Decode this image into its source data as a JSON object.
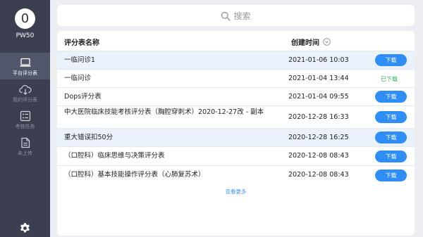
{
  "user": {
    "avatar": "0",
    "name": "PW50"
  },
  "nav": [
    {
      "label": "平台评分表",
      "icon": "laptop-icon",
      "active": true
    },
    {
      "label": "我的评分表",
      "icon": "cloud-download-icon",
      "active": false
    },
    {
      "label": "考核任务",
      "icon": "task-list-icon",
      "active": false
    },
    {
      "label": "未上传",
      "icon": "document-icon",
      "active": false
    }
  ],
  "search": {
    "placeholder": "搜索"
  },
  "table": {
    "header_name": "评分表名称",
    "header_date": "创建时间",
    "rows": [
      {
        "name": "一临问诊1",
        "date": "2021-01-06 10:03",
        "action": "下载",
        "downloaded": false
      },
      {
        "name": "一临问诊",
        "date": "2021-01-04 13:44",
        "action": "已下载",
        "downloaded": true
      },
      {
        "name": "Dops评分表",
        "date": "2021-01-04 09:55",
        "action": "下载",
        "downloaded": false
      },
      {
        "name": "中大医院临床技能考核评分表（胸腔穿刺术）2020-12-27改 - 副本",
        "date": "2020-12-28 16:33",
        "action": "下载",
        "downloaded": false
      },
      {
        "name": "重大错误扣50分",
        "date": "2020-12-28 16:25",
        "action": "下载",
        "downloaded": false
      },
      {
        "name": "（口腔科）临床思维与决策评分表",
        "date": "2020-12-08 08:43",
        "action": "下载",
        "downloaded": false
      },
      {
        "name": "（口腔科）基本技能操作评分表（心肺复苏术）",
        "date": "2020-12-08 08:43",
        "action": "下载",
        "downloaded": false
      }
    ],
    "more": "查看更多"
  },
  "colors": {
    "sidebar": "#3b3f4f",
    "accent": "#2f8ef5",
    "downloaded": "#2eb05f",
    "row_highlight": "#e9f2fb"
  }
}
